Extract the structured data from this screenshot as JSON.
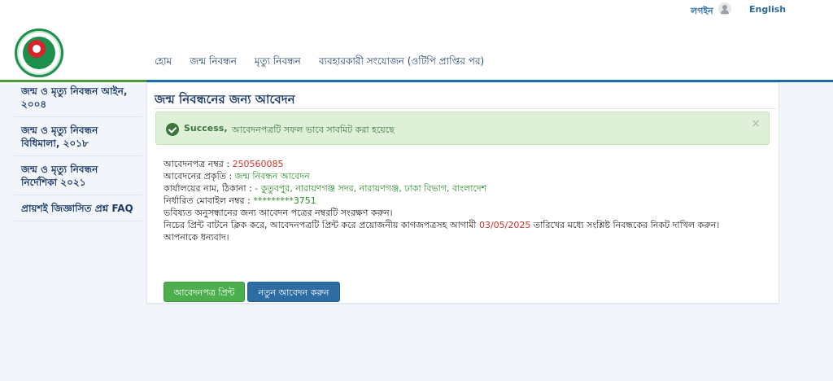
{
  "header": {
    "login": "লগইন",
    "language": "English"
  },
  "nav": [
    {
      "label": "হোম"
    },
    {
      "label": "জন্ম নিবন্ধন"
    },
    {
      "label": "মৃত্যু নিবন্ধন"
    },
    {
      "label": "ব্যবহারকারী সংযোজন (ওটিপি প্রাপ্তির পর)"
    }
  ],
  "sidebar": [
    {
      "label": "জন্ম ও মৃত্যু নিবন্ধন আইন, ২০০৪"
    },
    {
      "label": "জন্ম ও মৃত্যু নিবন্ধন বিধিমালা, ২০১৮"
    },
    {
      "label": "জন্ম ও মৃত্যু নিবন্ধন নির্দেশিকা ২০২১"
    },
    {
      "label": "প্রায়শই জিজ্ঞাসিত প্রশ্ন FAQ"
    }
  ],
  "main": {
    "title": "জন্ম নিবন্ধনের জন্য আবেদন",
    "alert": {
      "strong": "Success,",
      "text": "আবেদনপত্রটি সফল ভাবে সাবমিট করা হয়েছে",
      "close": "×"
    },
    "details": {
      "app_no_label": "আবেদনপত্র নম্বর : ",
      "app_no_value": "250560085",
      "type_label": "আবেদনের প্রকৃতি : ",
      "type_value": "জন্ম নিবন্ধন আবেদন",
      "office_label": "কার্যালয়ের নাম, ঠিকানা : ",
      "office_value": "- কুতুবপুর, নারায়ণগঞ্জ সদর, নারায়ণগঞ্জ, ঢাকা বিভাগ, বাংলাদেশ",
      "mobile_label": "নির্ধারিত মোবাইল নম্বর : ",
      "mobile_value": "*********3751",
      "note1": "ভবিষ্যত অনুসন্ধানের জন্য আবেদন পত্রের নম্বরটি সংরক্ষণ করুন।",
      "note2_pre": "নিচের প্রিন্ট বাটনে ক্লিক করে, আবেদনপত্রটি প্রিন্ট করে প্রয়োজনীয় কাগজপত্রসহ আগামী ",
      "note2_date": "03/05/2025",
      "note2_post": " তারিখের মধ্যে সংশ্লিষ্ট নিবন্ধকের নিকট দাখিল করুন।",
      "thanks": "আপনাকে ধন্যবাদ।"
    },
    "buttons": {
      "print": "আবেদনপত্র প্রিন্ট",
      "new": "নতুন আবেদন করুন"
    }
  }
}
